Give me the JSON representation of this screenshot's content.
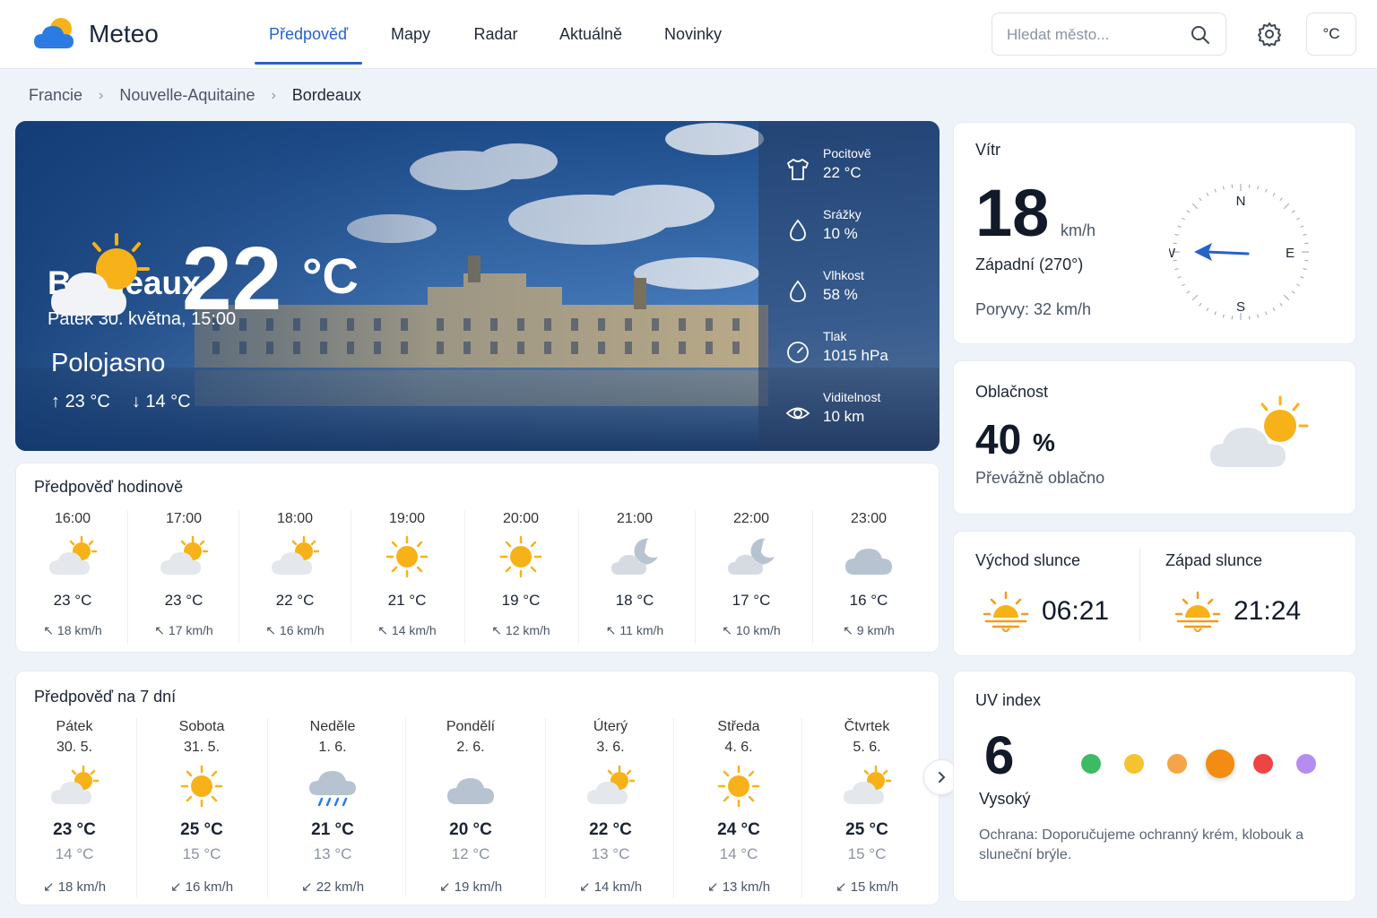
{
  "header": {
    "brand": "Meteo",
    "nav": [
      {
        "label": "Předpověď",
        "active": true
      },
      {
        "label": "Mapy",
        "active": false
      },
      {
        "label": "Radar",
        "active": false
      },
      {
        "label": "Aktuálně",
        "active": false
      },
      {
        "label": "Novinky",
        "active": false
      }
    ],
    "search_placeholder": "Hledat město...",
    "unit_label": "°C",
    "icons": {
      "logo": "sun-cloud-logo",
      "search": "search-icon",
      "settings": "gear-icon"
    }
  },
  "breadcrumb": [
    "Francie",
    "Nouvelle-Aquitaine",
    "Bordeaux"
  ],
  "hero": {
    "city": "Bordeaux",
    "datetime": "Pátek 30. května, 15:00",
    "temp": "22",
    "unit": "°C",
    "condition": "Polojasno",
    "high": "23 °C",
    "low": "14 °C",
    "icon": "partly-cloudy-icon",
    "stats": [
      {
        "label": "Pocitově",
        "value": "22 °C",
        "icon": "shirt-icon"
      },
      {
        "label": "Srážky",
        "value": "10 %",
        "icon": "drop-icon"
      },
      {
        "label": "Vlhkost",
        "value": "58 %",
        "icon": "drop-icon"
      },
      {
        "label": "Tlak",
        "value": "1015 hPa",
        "icon": "gauge-icon"
      },
      {
        "label": "Viditelnost",
        "value": "10 km",
        "icon": "eye-icon"
      }
    ]
  },
  "hourly": {
    "title": "Předpověď hodinově",
    "items": [
      {
        "time": "16:00",
        "icon": "partly-cloudy",
        "temp": "23 °C",
        "wind": "18 km/h"
      },
      {
        "time": "17:00",
        "icon": "partly-cloudy",
        "temp": "23 °C",
        "wind": "17 km/h"
      },
      {
        "time": "18:00",
        "icon": "partly-cloudy",
        "temp": "22 °C",
        "wind": "16 km/h"
      },
      {
        "time": "19:00",
        "icon": "sunny",
        "temp": "21 °C",
        "wind": "14 km/h"
      },
      {
        "time": "20:00",
        "icon": "sunny",
        "temp": "19 °C",
        "wind": "12 km/h"
      },
      {
        "time": "21:00",
        "icon": "night-cloudy",
        "temp": "18 °C",
        "wind": "11 km/h"
      },
      {
        "time": "22:00",
        "icon": "night-cloudy",
        "temp": "17 °C",
        "wind": "10 km/h"
      },
      {
        "time": "23:00",
        "icon": "cloudy",
        "temp": "16 °C",
        "wind": "9 km/h"
      }
    ]
  },
  "daily": {
    "title": "Předpověď na 7 dní",
    "items": [
      {
        "day": "Pátek",
        "date": "30. 5.",
        "icon": "partly-cloudy",
        "high": "23 °C",
        "low": "14 °C",
        "wind": "18 km/h"
      },
      {
        "day": "Sobota",
        "date": "31. 5.",
        "icon": "sunny",
        "high": "25 °C",
        "low": "15 °C",
        "wind": "16 km/h"
      },
      {
        "day": "Neděle",
        "date": "1. 6.",
        "icon": "rain",
        "high": "21 °C",
        "low": "13 °C",
        "wind": "22 km/h"
      },
      {
        "day": "Pondělí",
        "date": "2. 6.",
        "icon": "cloudy",
        "high": "20 °C",
        "low": "12 °C",
        "wind": "19 km/h"
      },
      {
        "day": "Úterý",
        "date": "3. 6.",
        "icon": "partly-cloudy",
        "high": "22 °C",
        "low": "13 °C",
        "wind": "14 km/h"
      },
      {
        "day": "Středa",
        "date": "4. 6.",
        "icon": "sunny",
        "high": "24 °C",
        "low": "14 °C",
        "wind": "13 km/h"
      },
      {
        "day": "Čtvrtek",
        "date": "5. 6.",
        "icon": "partly-cloudy",
        "high": "25 °C",
        "low": "15 °C",
        "wind": "15 km/h"
      }
    ]
  },
  "wind": {
    "title": "Vítr",
    "speed": "18",
    "unit": "km/h",
    "direction": "Západní (270°)",
    "gusts": "Poryvy: 32 km/h",
    "direction_deg": 270,
    "compass": {
      "n": "N",
      "e": "E",
      "s": "S",
      "w": "W"
    }
  },
  "clouds": {
    "title": "Oblačnost",
    "value": "40",
    "unit": "%",
    "desc": "Převážně oblačno"
  },
  "sun": {
    "sunrise_label": "Východ slunce",
    "sunrise": "06:21",
    "sunset_label": "Západ slunce",
    "sunset": "21:24"
  },
  "uv": {
    "title": "UV index",
    "value": "6",
    "level": "Vysoký",
    "advice": "Ochrana: Doporučujeme ochranný krém, klobouk a sluneční brýle.",
    "scale_colors": [
      "#3dbb63",
      "#f4c430",
      "#f5a548",
      "#f28c12",
      "#ef4444",
      "#b58cf0"
    ],
    "active_index": 3
  }
}
